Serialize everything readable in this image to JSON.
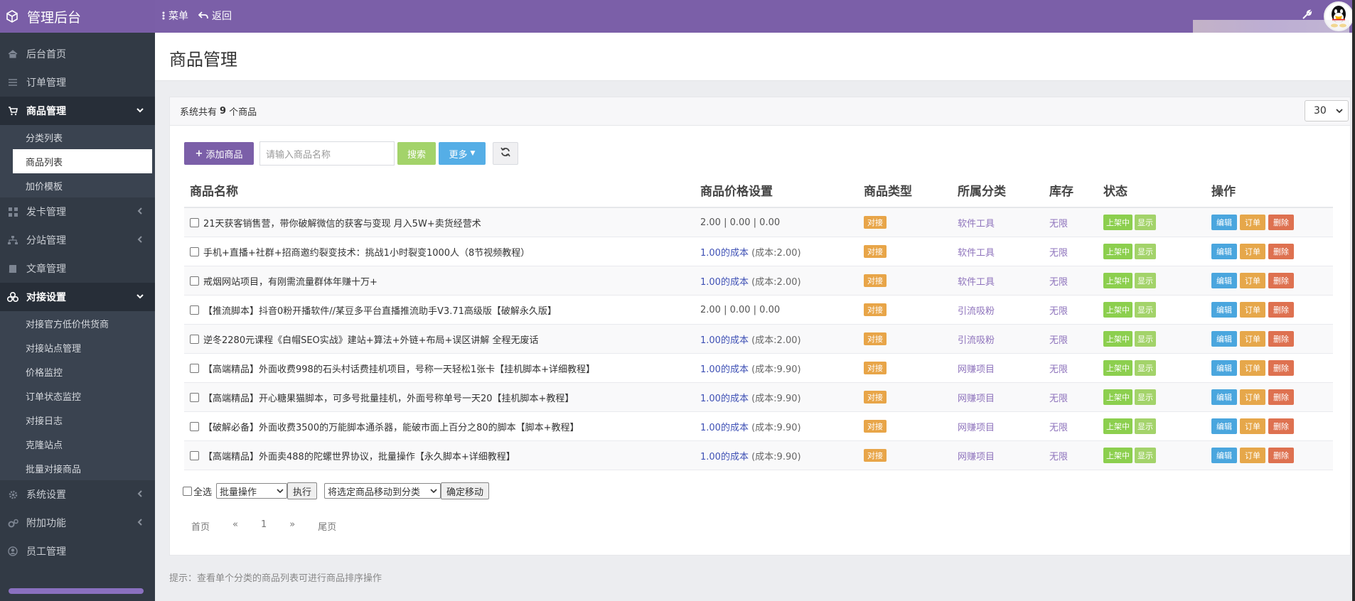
{
  "brand": {
    "title": "管理后台"
  },
  "topbar": {
    "menu_label": "菜单",
    "back_label": "返回"
  },
  "sidebar": {
    "items": [
      {
        "label": "后台首页"
      },
      {
        "label": "订单管理"
      },
      {
        "label": "商品管理"
      },
      {
        "label": "发卡管理"
      },
      {
        "label": "分站管理"
      },
      {
        "label": "文章管理"
      },
      {
        "label": "对接设置"
      },
      {
        "label": "系统设置"
      },
      {
        "label": "附加功能"
      },
      {
        "label": "员工管理"
      }
    ],
    "goods_sub": [
      {
        "label": "分类列表"
      },
      {
        "label": "商品列表"
      },
      {
        "label": "加价模板"
      }
    ],
    "dock_sub": [
      {
        "label": "对接官方低价供货商"
      },
      {
        "label": "对接站点管理"
      },
      {
        "label": "价格监控"
      },
      {
        "label": "订单状态监控"
      },
      {
        "label": "对接日志"
      },
      {
        "label": "克隆站点"
      },
      {
        "label": "批量对接商品"
      }
    ]
  },
  "page": {
    "title": "商品管理"
  },
  "panel": {
    "summary_prefix": "系统共有",
    "summary_count": "9",
    "summary_suffix": "个商品",
    "page_size": "30"
  },
  "toolbar": {
    "add_label": "添加商品",
    "search_placeholder": "请输入商品名称",
    "search_label": "搜索",
    "more_label": "更多"
  },
  "table": {
    "headers": {
      "name": "商品名称",
      "price": "商品价格设置",
      "type": "商品类型",
      "category": "所属分类",
      "stock": "库存",
      "status": "状态",
      "ops": "操作"
    },
    "rows": [
      {
        "name": "21天获客销售营，带你破解微信的获客与变现 月入5W+卖货经营术",
        "price_plain": "2.00 | 0.00 | 0.00",
        "price_link": "",
        "price_cost": "",
        "type": "对接",
        "category": "软件工具",
        "stock": "无限",
        "status_up": "上架中",
        "status_show": "显示",
        "op_edit": "编辑",
        "op_order": "订单",
        "op_delete": "删除"
      },
      {
        "name": "手机+直播+社群+招商邀约裂变技术：挑战1小时裂变1000人（8节视频教程）",
        "price_plain": "",
        "price_link": "1.00的成本",
        "price_cost": "(成本:2.00)",
        "type": "对接",
        "category": "软件工具",
        "stock": "无限",
        "status_up": "上架中",
        "status_show": "显示",
        "op_edit": "编辑",
        "op_order": "订单",
        "op_delete": "删除"
      },
      {
        "name": "戒烟网站项目，有刚需流量群体年赚十万+",
        "price_plain": "",
        "price_link": "1.00的成本",
        "price_cost": "(成本:2.00)",
        "type": "对接",
        "category": "软件工具",
        "stock": "无限",
        "status_up": "上架中",
        "status_show": "显示",
        "op_edit": "编辑",
        "op_order": "订单",
        "op_delete": "删除"
      },
      {
        "name": "【推流脚本】抖音0粉开播软件//某豆多平台直播推流助手V3.71高级版【破解永久版】",
        "price_plain": "2.00 | 0.00 | 0.00",
        "price_link": "",
        "price_cost": "",
        "type": "对接",
        "category": "引流吸粉",
        "stock": "无限",
        "status_up": "上架中",
        "status_show": "显示",
        "op_edit": "编辑",
        "op_order": "订单",
        "op_delete": "删除"
      },
      {
        "name": "逆冬2280元课程《白帽SEO实战》建站+算法+外链+布局+误区讲解 全程无废话",
        "price_plain": "",
        "price_link": "1.00的成本",
        "price_cost": "(成本:2.00)",
        "type": "对接",
        "category": "引流吸粉",
        "stock": "无限",
        "status_up": "上架中",
        "status_show": "显示",
        "op_edit": "编辑",
        "op_order": "订单",
        "op_delete": "删除"
      },
      {
        "name": "【高端精品】外面收费998的石头村话费挂机项目，号称一天轻松1张卡【挂机脚本+详细教程】",
        "price_plain": "",
        "price_link": "1.00的成本",
        "price_cost": "(成本:9.90)",
        "type": "对接",
        "category": "网赚项目",
        "stock": "无限",
        "status_up": "上架中",
        "status_show": "显示",
        "op_edit": "编辑",
        "op_order": "订单",
        "op_delete": "删除"
      },
      {
        "name": "【高端精品】开心糖果猫脚本，可多号批量挂机，外面号称单号一天20【挂机脚本+教程】",
        "price_plain": "",
        "price_link": "1.00的成本",
        "price_cost": "(成本:9.90)",
        "type": "对接",
        "category": "网赚项目",
        "stock": "无限",
        "status_up": "上架中",
        "status_show": "显示",
        "op_edit": "编辑",
        "op_order": "订单",
        "op_delete": "删除"
      },
      {
        "name": "【破解必备】外面收费3500的万能脚本通杀器，能破市面上百分之80的脚本【脚本+教程】",
        "price_plain": "",
        "price_link": "1.00的成本",
        "price_cost": "(成本:9.90)",
        "type": "对接",
        "category": "网赚项目",
        "stock": "无限",
        "status_up": "上架中",
        "status_show": "显示",
        "op_edit": "编辑",
        "op_order": "订单",
        "op_delete": "删除"
      },
      {
        "name": "【高端精品】外面卖488的陀螺世界协议，批量操作【永久脚本+详细教程】",
        "price_plain": "",
        "price_link": "1.00的成本",
        "price_cost": "(成本:9.90)",
        "type": "对接",
        "category": "网赚项目",
        "stock": "无限",
        "status_up": "上架中",
        "status_show": "显示",
        "op_edit": "编辑",
        "op_order": "订单",
        "op_delete": "删除"
      }
    ]
  },
  "bulk": {
    "select_all": "全选",
    "action_select": "批量操作",
    "execute": "执行",
    "move_select": "将选定商品移动到分类",
    "confirm_move": "确定移动"
  },
  "pager": {
    "first": "首页",
    "prev": "«",
    "current": "1",
    "next": "»",
    "last": "尾页"
  },
  "hint": "提示：查看单个分类的商品列表可进行商品排序操作",
  "colors": {
    "brand": "#7b5fa8",
    "sidebar": "#323a45",
    "green": "#a3d36a",
    "blue": "#55aee6",
    "orange": "#e8a548",
    "red": "#de7150"
  }
}
